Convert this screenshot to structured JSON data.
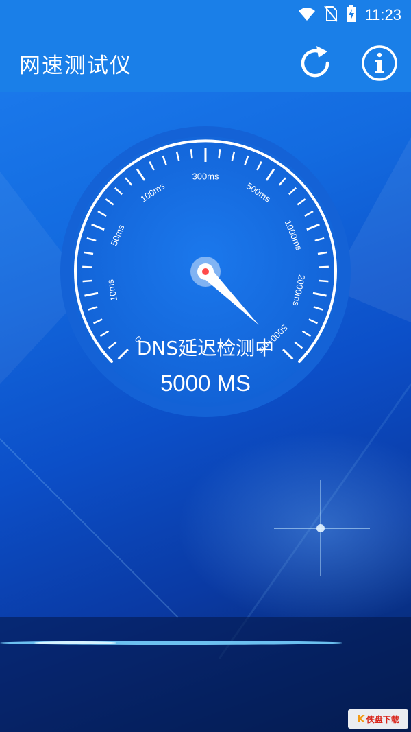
{
  "status_bar": {
    "time": "11:23",
    "icons": [
      "wifi-icon",
      "no-sim-icon",
      "battery-charging-icon"
    ]
  },
  "app_bar": {
    "title": "网速测试仪",
    "actions": [
      {
        "name": "refresh-icon"
      },
      {
        "name": "info-icon"
      }
    ]
  },
  "gauge": {
    "tick_labels": [
      "0",
      "10ms",
      "50ms",
      "100ms",
      "300ms",
      "500ms",
      "1000ms",
      "2000ms",
      "5000+ms"
    ],
    "needle_value": "5000+ms",
    "status_text": "DNS延迟检测中",
    "value_text": "5000 MS"
  },
  "watermark": {
    "logo": "K",
    "text": "侠盘下载"
  },
  "colors": {
    "app_bar": "#1a7fe8",
    "background": "#0c4fc8",
    "dial": "#1565d8",
    "needle_center": "#ff4a4a"
  }
}
